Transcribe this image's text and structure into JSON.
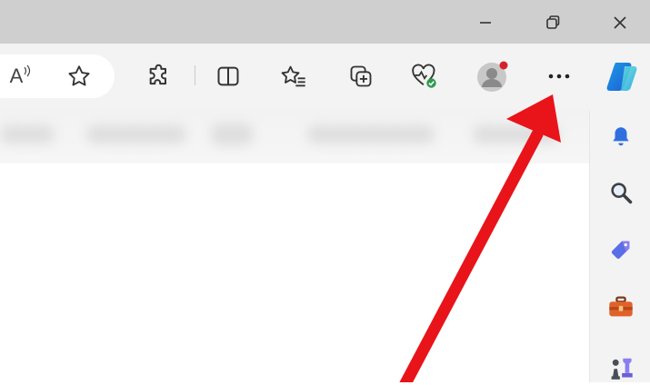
{
  "window_controls": {
    "minimize_icon": "minimize-icon",
    "restore_icon": "restore-icon",
    "close_icon": "close-icon"
  },
  "toolbar": {
    "read_aloud_label": "A",
    "icons": [
      "read-aloud-icon",
      "favorite-star-icon",
      "extensions-icon",
      "split-screen-icon",
      "favorites-icon",
      "collections-icon",
      "browser-essentials-icon",
      "profile-avatar-icon",
      "more-options-icon",
      "copilot-icon"
    ]
  },
  "sidebar": {
    "icons": [
      "notifications-bell-icon",
      "search-icon",
      "shopping-tag-icon",
      "tools-briefcase-icon",
      "games-chess-icon"
    ]
  },
  "colors": {
    "arrow": "#e8141a",
    "notification_dot": "#d6212b",
    "health_badge": "#2e9b4f",
    "accent_blue": "#2f6fe0"
  }
}
